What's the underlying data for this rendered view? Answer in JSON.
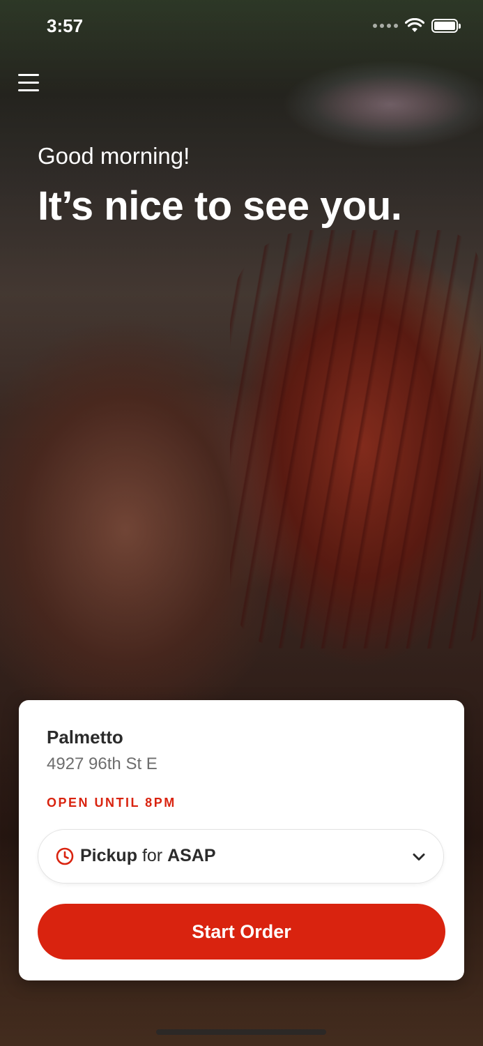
{
  "status_bar": {
    "time": "3:57",
    "icons": [
      "signal-icon",
      "wifi-icon",
      "battery-icon"
    ]
  },
  "header": {
    "menu_icon": "hamburger-menu-icon"
  },
  "hero": {
    "greeting": "Good morning!",
    "headline": "It’s nice to see you."
  },
  "location_card": {
    "store_name": "Palmetto",
    "address": "4927 96th St E",
    "hours": "OPEN UNTIL 8PM",
    "order_mode": {
      "icon": "clock-icon",
      "method": "Pickup",
      "connector": "for",
      "time": "ASAP",
      "chevron_icon": "chevron-down-icon"
    },
    "start_button_label": "Start Order"
  },
  "colors": {
    "accent": "#d9230f",
    "card_background": "#ffffff",
    "text_primary": "#2b2b2b",
    "text_secondary": "#6d6d6d"
  }
}
